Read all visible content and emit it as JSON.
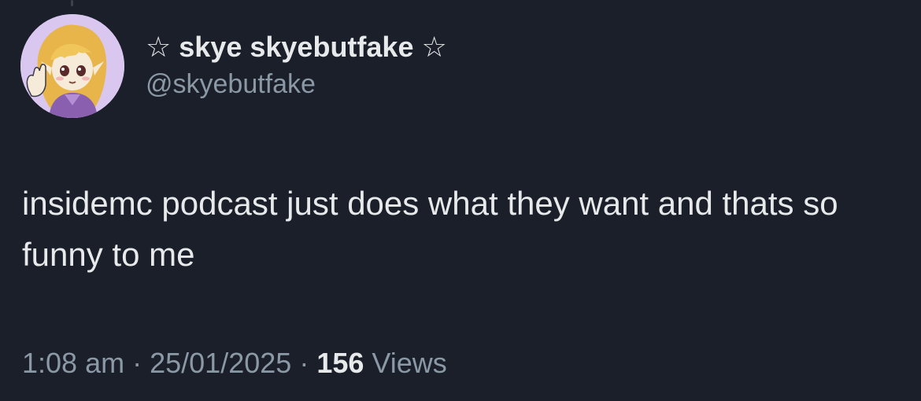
{
  "tweet": {
    "display_name": "☆ skye skyebutfake ☆",
    "handle": "@skyebutfake",
    "text": "insidemc podcast just does what they want and thats so funny to me",
    "time": "1:08 am",
    "separator": "·",
    "date": "25/01/2025",
    "views_count": "156",
    "views_label": "Views"
  },
  "colors": {
    "background": "#1a1f2a",
    "primary_text": "#e7e9ea",
    "secondary_text": "#8b98a5"
  }
}
